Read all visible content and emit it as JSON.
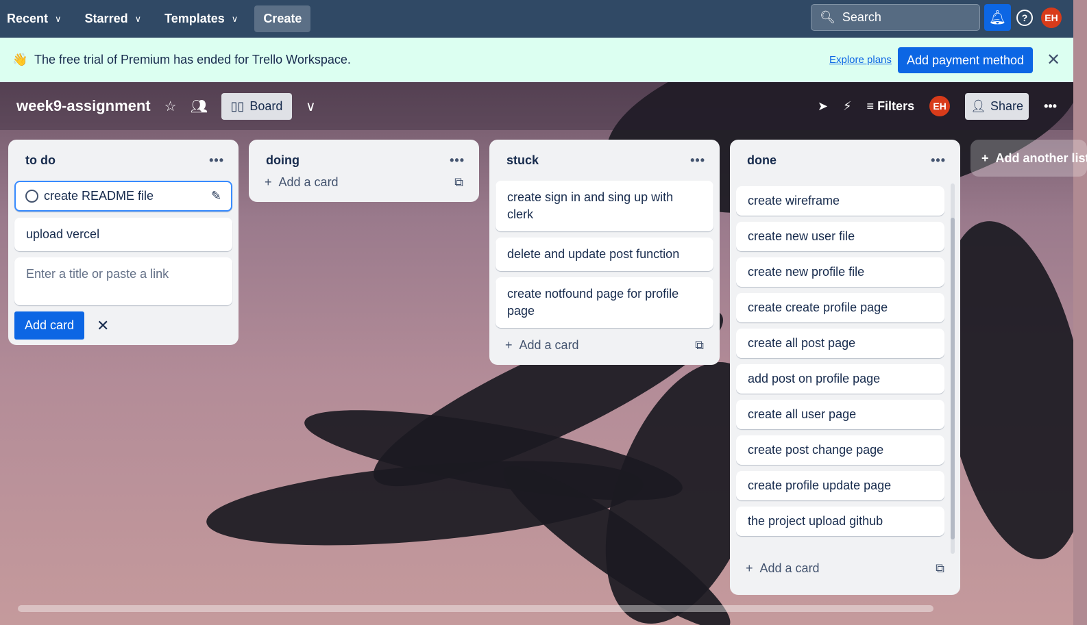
{
  "nav": {
    "recent": "Recent",
    "starred": "Starred",
    "templates": "Templates",
    "create": "Create",
    "search_placeholder": "Search",
    "avatar": "EH"
  },
  "banner": {
    "message": "The free trial of Premium has ended for Trello Workspace.",
    "explore": "Explore plans",
    "pay": "Add payment method"
  },
  "board": {
    "title": "week9-assignment",
    "view": "Board",
    "filters": "Filters",
    "avatar": "EH",
    "share": "Share"
  },
  "lists": [
    {
      "title": "to do",
      "cards": [
        "create README file",
        "upload vercel"
      ],
      "composer_placeholder": "Enter a title or paste a link",
      "add_card_button": "Add card"
    },
    {
      "title": "doing",
      "cards": [],
      "add": "Add a card"
    },
    {
      "title": "stuck",
      "cards": [
        "create sign in and sing up with clerk",
        "delete and update post function",
        "create notfound page for profile page"
      ],
      "add": "Add a card"
    },
    {
      "title": "done",
      "cards": [
        "create wireframe",
        "create new user file",
        "create new profile file",
        "create create profile page",
        "create all post page",
        "add post on profile page",
        "create all user page",
        "create post change page",
        "create profile update page",
        "the project upload github"
      ],
      "add": "Add a card"
    }
  ],
  "add_list": "Add another list"
}
